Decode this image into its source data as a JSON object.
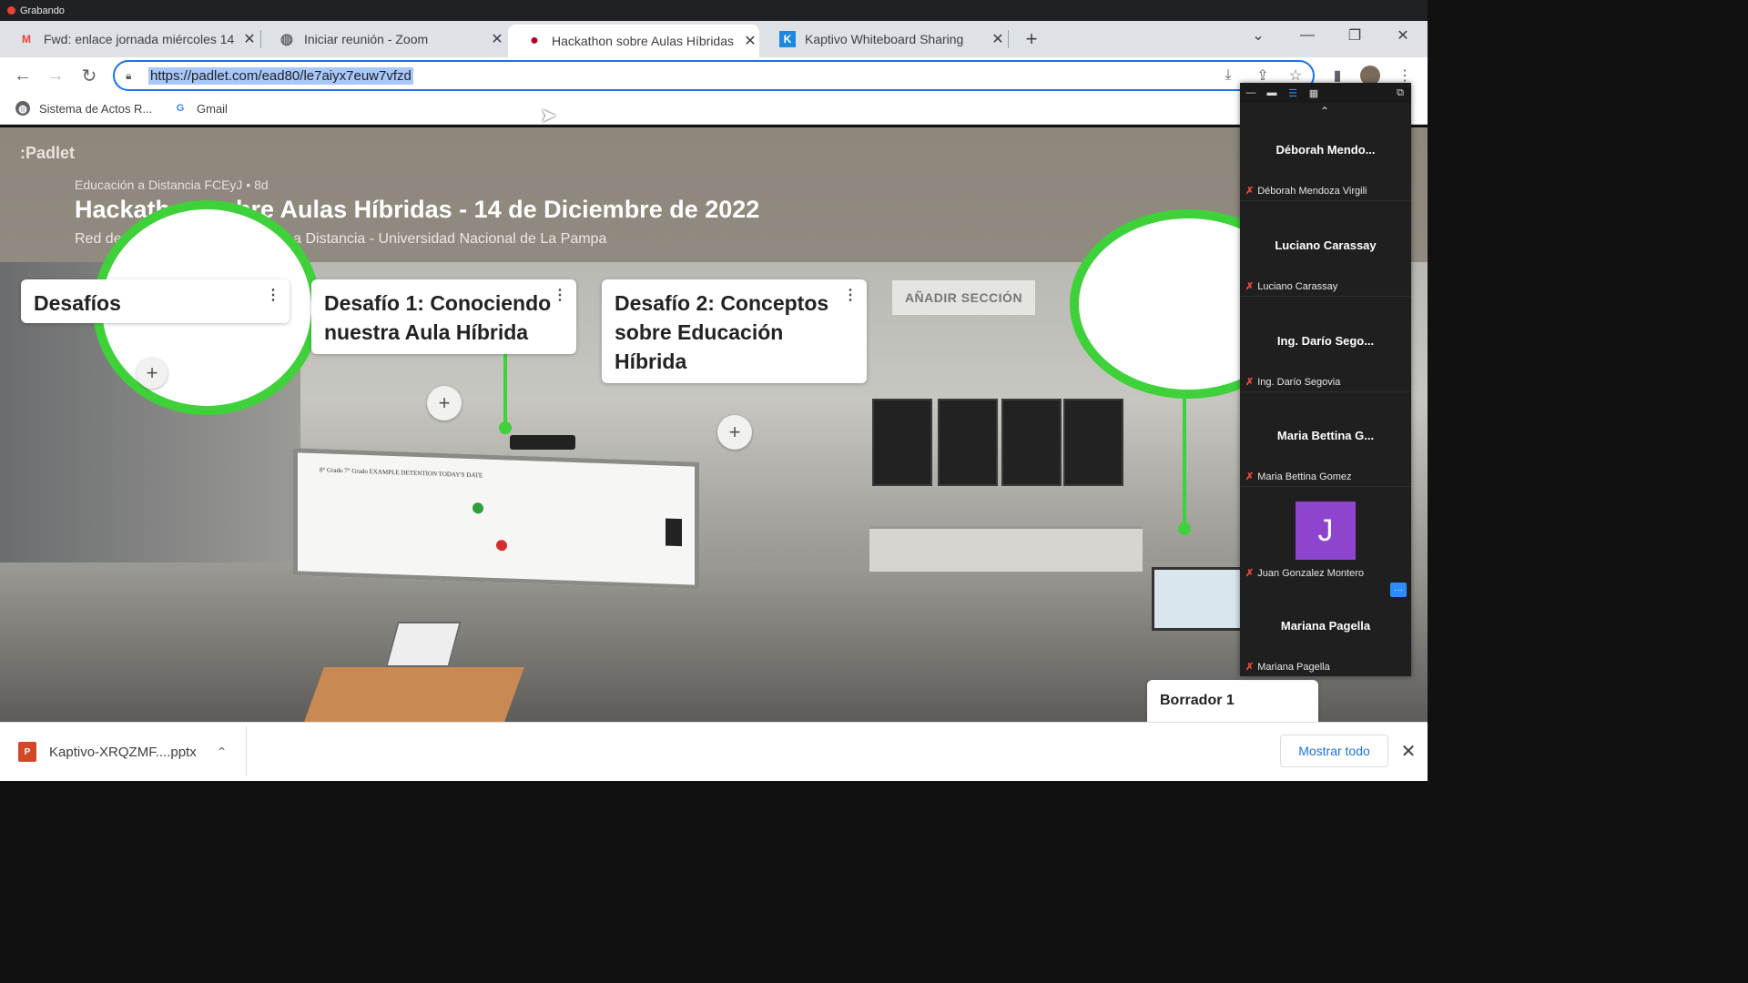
{
  "recording": {
    "label": "Grabando"
  },
  "tabs": [
    {
      "title": "Fwd: enlace jornada miércoles 14",
      "icon": "gmail-icon",
      "glyph": "M"
    },
    {
      "title": "Iniciar reunión - Zoom",
      "icon": "globe-icon",
      "glyph": "◍"
    },
    {
      "title": "Hackathon sobre Aulas Híbridas",
      "icon": "padlet-icon",
      "glyph": "●",
      "active": true
    },
    {
      "title": "Kaptivo Whiteboard Sharing",
      "icon": "kaptivo-icon",
      "glyph": "K"
    }
  ],
  "omnibox": {
    "url": "https://padlet.com/ead80/le7aiyx7euw7vfzd"
  },
  "bookmarks": [
    {
      "label": "Sistema de Actos R...",
      "icon": "globe-icon"
    },
    {
      "label": "Gmail",
      "icon": "google-icon"
    }
  ],
  "padlet": {
    "logo": ":Padlet",
    "meta": "Educación a Distancia FCEyJ • 8d",
    "title": "Hackathon sobre Aulas Híbridas - 14 de Diciembre de 2022",
    "subtitle": "Red de Referentes de Educación a Distancia - Universidad Nacional de La Pampa",
    "add_section": "AÑADIR SECCIÓN",
    "sections": [
      {
        "title": "Desafíos"
      },
      {
        "title": "Desafío 1: Conociendo nuestra Aula Híbrida"
      },
      {
        "title": "Desafío 2: Conceptos sobre Educación Híbrida"
      }
    ],
    "draft": "Borrador 1"
  },
  "zoom": {
    "participants": [
      {
        "display": "Déborah Mendo...",
        "name": "Déborah Mendoza Virgili"
      },
      {
        "display": "Luciano Carassay",
        "name": "Luciano Carassay"
      },
      {
        "display": "Ing. Darío Sego...",
        "name": "Ing. Darío Segovia"
      },
      {
        "display": "Maria Bettina G...",
        "name": "Maria Bettina Gomez"
      },
      {
        "display": "J",
        "name": "Juan Gonzalez Montero",
        "avatar_color": "#8e44ce"
      },
      {
        "display": "Mariana Pagella",
        "name": "Mariana Pagella"
      }
    ]
  },
  "download": {
    "file": "Kaptivo-XRQZMF....pptx",
    "show_all": "Mostrar todo"
  },
  "colors": {
    "padlet_green": "#3fd13a",
    "focus_blue": "#1a73e8",
    "zoom_bg": "#1f1f1f"
  }
}
